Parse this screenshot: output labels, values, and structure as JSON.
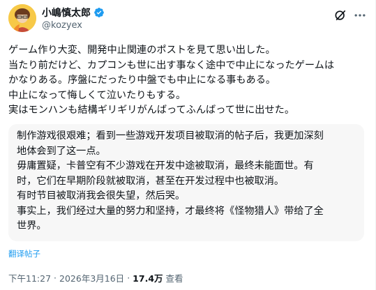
{
  "author": {
    "display_name": "小嶋慎太郎",
    "handle": "@kozyex",
    "verified_color": "#1d9bf0"
  },
  "icons": {
    "avatar": "avatar",
    "verified": "verified-badge-icon",
    "grok": "grok-icon",
    "more": "more-icon"
  },
  "post": {
    "lines": [
      "ゲーム作り大変、開発中止関連のポストを見て思い出した。",
      "当たり前だけど、カプコンも世に出す事なく途中で中止になったゲームは",
      "かなりある。序盤にだったり中盤でも中止になる事もある。",
      "中止になって悔しくて泣いたりもする。",
      "実はモンハンも結構ギリギリがんばってふんばって世に出せた。"
    ]
  },
  "translation": {
    "lines": [
      "制作游戏很艰难；看到一些游戏开发项目被取消的帖子后，我更加深刻",
      "地体会到了这一点。",
      "毋庸置疑，卡普空有不少游戏在开发中途被取消，最终未能面世。有",
      "时，它们在早期阶段就被取消，甚至在开发过程中也被取消。",
      "有时节目被取消我会很失望，然后哭。",
      "事实上，我们经过大量的努力和坚持，才最终将《怪物猎人》带给了全",
      "世界。"
    ],
    "link_label": "翻译帖子",
    "link_color": "#1d9bf0"
  },
  "meta": {
    "time": "下午11:27",
    "separator": "·",
    "date": "2026年3月16日",
    "views_count": "17.4万",
    "views_label": "查看"
  }
}
